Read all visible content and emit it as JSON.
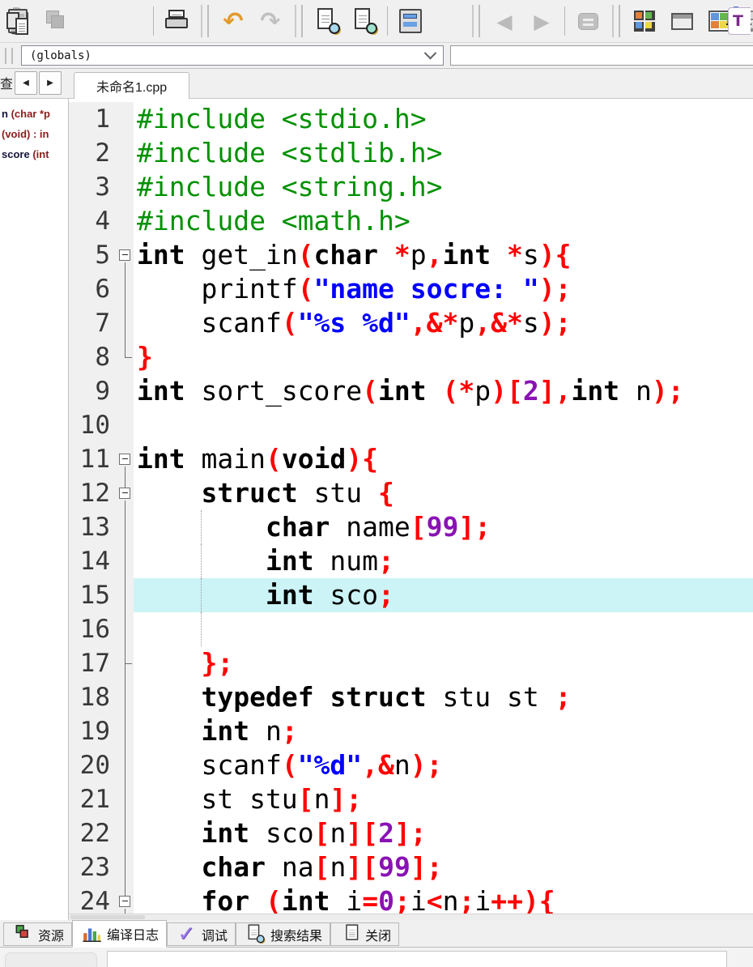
{
  "colors": {
    "preprocessor": "#009100",
    "keyword": "#000000",
    "symbol": "#ff0000",
    "string": "#0000ff",
    "number": "#8a12b4",
    "plain": "#000000",
    "line_highlight": "#ccf4f7",
    "gutter_bg": "#f0f0f0"
  },
  "toolbar": {
    "row1": [
      {
        "kind": "sliver",
        "name": "clipped-left-icon"
      },
      {
        "kind": "pages",
        "name": "save-all-icon",
        "disabled": true
      },
      {
        "kind": "docx",
        "name": "close-file-icon",
        "glyph": "✕",
        "cls": "g-docx"
      },
      {
        "kind": "docsx",
        "name": "close-all-icon",
        "glyph": "✕",
        "cls": "g-docx2"
      },
      {
        "kind": "sep"
      },
      {
        "kind": "printer",
        "name": "print-icon"
      },
      {
        "kind": "grip"
      },
      {
        "kind": "glyph",
        "name": "undo-icon",
        "glyph": "↶",
        "cls": "g-undo"
      },
      {
        "kind": "glyph",
        "name": "redo-icon",
        "glyph": "↷",
        "cls": "g-redo",
        "disabled": true
      },
      {
        "kind": "grip"
      },
      {
        "kind": "find",
        "name": "find-icon"
      },
      {
        "kind": "find2",
        "name": "replace-icon"
      },
      {
        "kind": "sep"
      },
      {
        "kind": "listbars",
        "name": "goto-function-icon"
      },
      {
        "kind": "gotoline",
        "name": "goto-line-icon",
        "glyph": "▶",
        "cls": "g-goto"
      },
      {
        "kind": "grip"
      },
      {
        "kind": "glyph",
        "name": "back-icon",
        "glyph": "◀",
        "cls": "g-nav",
        "disabled": true
      },
      {
        "kind": "glyph",
        "name": "forward-icon",
        "glyph": "▶",
        "cls": "g-nav",
        "disabled": true
      },
      {
        "kind": "sep"
      },
      {
        "kind": "eqbadge",
        "name": "bookmark-icon",
        "disabled": true
      },
      {
        "kind": "grip"
      },
      {
        "kind": "sq4c",
        "name": "new-project-icon"
      },
      {
        "kind": "win",
        "name": "new-window-icon"
      },
      {
        "kind": "winc",
        "name": "open-project-icon"
      },
      {
        "kind": "sq4g",
        "name": "project-options-icon"
      },
      {
        "kind": "sep"
      },
      {
        "kind": "glyph",
        "name": "syntax-check-icon",
        "glyph": "✓",
        "cls": "g-check"
      },
      {
        "kind": "sep"
      },
      {
        "kind": "glyph",
        "name": "abort-icon",
        "glyph": "✕",
        "cls": "g-abort"
      },
      {
        "kind": "sep"
      },
      {
        "kind": "chart",
        "name": "profile-analysis-icon"
      },
      {
        "kind": "chartx",
        "name": "delete-profile-icon",
        "glyph": "✕",
        "cls": "g-chartx"
      },
      {
        "kind": "grip"
      },
      {
        "kind": "tpartial",
        "name": "clipped-right-icon",
        "glyph": "T",
        "cls": "g-tpart",
        "absright": true
      }
    ]
  },
  "navbar": {
    "scope_value": "(globals)"
  },
  "tabrow": {
    "clipped_label": "查",
    "prev_glyph": "◀",
    "next_glyph": "▶",
    "file_tab": "未命名1.cpp"
  },
  "sidebar": {
    "items": [
      {
        "name": "n ",
        "sig": "(char *p"
      },
      {
        "name": "",
        "sig": "(void) : in"
      },
      {
        "name": "score ",
        "sig": "(int"
      }
    ]
  },
  "editor": {
    "lines": [
      {
        "n": 1,
        "fold": "",
        "seg": [
          [
            "pp",
            "#include <stdio.h>"
          ]
        ]
      },
      {
        "n": 2,
        "fold": "",
        "seg": [
          [
            "pp",
            "#include <stdlib.h>"
          ]
        ]
      },
      {
        "n": 3,
        "fold": "",
        "seg": [
          [
            "pp",
            "#include <string.h>"
          ]
        ]
      },
      {
        "n": 4,
        "fold": "",
        "seg": [
          [
            "pp",
            "#include <math.h>"
          ]
        ]
      },
      {
        "n": 5,
        "fold": "box",
        "seg": [
          [
            "kw",
            "int"
          ],
          [
            "t",
            " get_in"
          ],
          [
            "sym",
            "("
          ],
          [
            "kw",
            "char"
          ],
          [
            "t",
            " "
          ],
          [
            "sym",
            "*"
          ],
          [
            "t",
            "p"
          ],
          [
            "sym",
            ","
          ],
          [
            "kw",
            "int"
          ],
          [
            "t",
            " "
          ],
          [
            "sym",
            "*"
          ],
          [
            "t",
            "s"
          ],
          [
            "sym",
            "){"
          ]
        ]
      },
      {
        "n": 6,
        "fold": "line",
        "seg": [
          [
            "t",
            "    printf"
          ],
          [
            "sym",
            "("
          ],
          [
            "str",
            "\"name socre: \""
          ],
          [
            "sym",
            ");"
          ]
        ]
      },
      {
        "n": 7,
        "fold": "line",
        "seg": [
          [
            "t",
            "    scanf"
          ],
          [
            "sym",
            "("
          ],
          [
            "str",
            "\"%s %d\""
          ],
          [
            "sym",
            ",&*"
          ],
          [
            "t",
            "p"
          ],
          [
            "sym",
            ",&*"
          ],
          [
            "t",
            "s"
          ],
          [
            "sym",
            ");"
          ]
        ]
      },
      {
        "n": 8,
        "fold": "end",
        "seg": [
          [
            "sym",
            "}"
          ]
        ]
      },
      {
        "n": 9,
        "fold": "",
        "seg": [
          [
            "kw",
            "int"
          ],
          [
            "t",
            " sort_score"
          ],
          [
            "sym",
            "("
          ],
          [
            "kw",
            "int"
          ],
          [
            "t",
            " "
          ],
          [
            "sym",
            "(*"
          ],
          [
            "t",
            "p"
          ],
          [
            "sym",
            ")["
          ],
          [
            "num",
            "2"
          ],
          [
            "sym",
            "],"
          ],
          [
            "kw",
            "int"
          ],
          [
            "t",
            " n"
          ],
          [
            "sym",
            ");"
          ]
        ]
      },
      {
        "n": 10,
        "fold": "",
        "seg": []
      },
      {
        "n": 11,
        "fold": "box",
        "seg": [
          [
            "kw",
            "int"
          ],
          [
            "t",
            " main"
          ],
          [
            "sym",
            "("
          ],
          [
            "kw",
            "void"
          ],
          [
            "sym",
            "){"
          ]
        ]
      },
      {
        "n": 12,
        "fold": "boxc",
        "seg": [
          [
            "t",
            "    "
          ],
          [
            "kw",
            "struct"
          ],
          [
            "t",
            " stu "
          ],
          [
            "sym",
            "{"
          ]
        ]
      },
      {
        "n": 13,
        "fold": "line",
        "guide": true,
        "seg": [
          [
            "t",
            "        "
          ],
          [
            "kw",
            "char"
          ],
          [
            "t",
            " name"
          ],
          [
            "sym",
            "["
          ],
          [
            "num",
            "99"
          ],
          [
            "sym",
            "];"
          ]
        ]
      },
      {
        "n": 14,
        "fold": "line",
        "guide": true,
        "seg": [
          [
            "t",
            "        "
          ],
          [
            "kw",
            "int"
          ],
          [
            "t",
            " num"
          ],
          [
            "sym",
            ";"
          ]
        ]
      },
      {
        "n": 15,
        "fold": "line",
        "guide": true,
        "hl": true,
        "seg": [
          [
            "t",
            "        "
          ],
          [
            "kw",
            "int"
          ],
          [
            "t",
            " sco"
          ],
          [
            "sym",
            ";"
          ]
        ]
      },
      {
        "n": 16,
        "fold": "line",
        "guide": true,
        "seg": []
      },
      {
        "n": 17,
        "fold": "tick",
        "seg": [
          [
            "t",
            "    "
          ],
          [
            "sym",
            "};"
          ]
        ]
      },
      {
        "n": 18,
        "fold": "line",
        "seg": [
          [
            "t",
            "    "
          ],
          [
            "kw",
            "typedef"
          ],
          [
            "t",
            " "
          ],
          [
            "kw",
            "struct"
          ],
          [
            "t",
            " stu st "
          ],
          [
            "sym",
            ";"
          ]
        ]
      },
      {
        "n": 19,
        "fold": "line",
        "seg": [
          [
            "t",
            "    "
          ],
          [
            "kw",
            "int"
          ],
          [
            "t",
            " n"
          ],
          [
            "sym",
            ";"
          ]
        ]
      },
      {
        "n": 20,
        "fold": "line",
        "seg": [
          [
            "t",
            "    scanf"
          ],
          [
            "sym",
            "("
          ],
          [
            "str",
            "\"%d\""
          ],
          [
            "sym",
            ",&"
          ],
          [
            "t",
            "n"
          ],
          [
            "sym",
            ");"
          ]
        ]
      },
      {
        "n": 21,
        "fold": "line",
        "seg": [
          [
            "t",
            "    st stu"
          ],
          [
            "sym",
            "["
          ],
          [
            "t",
            "n"
          ],
          [
            "sym",
            "];"
          ]
        ]
      },
      {
        "n": 22,
        "fold": "line",
        "seg": [
          [
            "t",
            "    "
          ],
          [
            "kw",
            "int"
          ],
          [
            "t",
            " sco"
          ],
          [
            "sym",
            "["
          ],
          [
            "t",
            "n"
          ],
          [
            "sym",
            "]["
          ],
          [
            "num",
            "2"
          ],
          [
            "sym",
            "];"
          ]
        ]
      },
      {
        "n": 23,
        "fold": "line",
        "seg": [
          [
            "t",
            "    "
          ],
          [
            "kw",
            "char"
          ],
          [
            "t",
            " na"
          ],
          [
            "sym",
            "["
          ],
          [
            "t",
            "n"
          ],
          [
            "sym",
            "]["
          ],
          [
            "num",
            "99"
          ],
          [
            "sym",
            "];"
          ]
        ]
      },
      {
        "n": 24,
        "fold": "boxc",
        "seg": [
          [
            "t",
            "    "
          ],
          [
            "kw",
            "for"
          ],
          [
            "t",
            " "
          ],
          [
            "sym",
            "("
          ],
          [
            "kw",
            "int"
          ],
          [
            "t",
            " i"
          ],
          [
            "sym",
            "="
          ],
          [
            "num",
            "0"
          ],
          [
            "sym",
            ";"
          ],
          [
            "t",
            "i"
          ],
          [
            "sym",
            "<"
          ],
          [
            "t",
            "n"
          ],
          [
            "sym",
            ";"
          ],
          [
            "t",
            "i"
          ],
          [
            "sym",
            "++){"
          ]
        ]
      }
    ]
  },
  "bottom_tabs": {
    "active_index": 1,
    "tabs": [
      {
        "label": "资源",
        "icon": "pagesc",
        "name": "tab-resources"
      },
      {
        "label": "编译日志",
        "icon": "chart",
        "name": "tab-compile-log"
      },
      {
        "label": "调试",
        "icon": "glyph",
        "glyph": "✓",
        "cls": "g-check",
        "name": "tab-debug"
      },
      {
        "label": "搜索结果",
        "icon": "find",
        "name": "tab-search-results"
      },
      {
        "label": "关闭",
        "icon": "docx",
        "glyph": "✕",
        "cls": "g-docx",
        "name": "tab-close-panel"
      }
    ]
  }
}
